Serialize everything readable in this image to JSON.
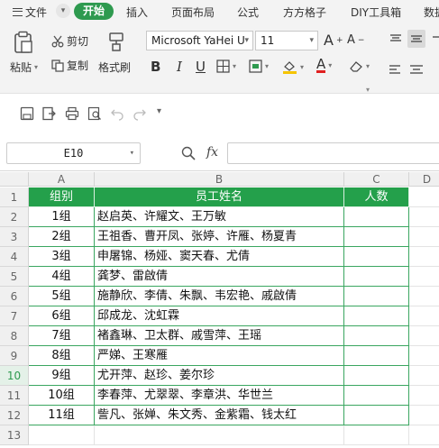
{
  "menubar": {
    "file": "文件",
    "start": "开始",
    "tabs": [
      "插入",
      "页面布局",
      "公式",
      "方方格子",
      "DIY工具箱",
      "数据"
    ]
  },
  "ribbon": {
    "paste": "粘贴",
    "cut": "剪切",
    "copy": "复制",
    "format_painter": "格式刷",
    "font_name": "Microsoft YaHei U",
    "font_size": "11"
  },
  "formula_bar": {
    "cell_ref": "E10",
    "fx": "fx",
    "formula": ""
  },
  "sheet": {
    "columns": [
      "A",
      "B",
      "C",
      "D"
    ],
    "row_numbers": [
      "1",
      "2",
      "3",
      "4",
      "5",
      "6",
      "7",
      "8",
      "9",
      "10",
      "11",
      "12",
      "13"
    ],
    "selected_row": "10",
    "header": [
      "组别",
      "员工姓名",
      "人数"
    ],
    "rows": [
      {
        "group": "1组",
        "names": "赵启英、许耀文、王万敏",
        "count": ""
      },
      {
        "group": "2组",
        "names": "王祖香、曹开凤、张婷、许雁、杨夏青",
        "count": ""
      },
      {
        "group": "3组",
        "names": "申屠锦、杨娅、窦天春、尤倩",
        "count": ""
      },
      {
        "group": "4组",
        "names": "龚梦、雷啟倩",
        "count": ""
      },
      {
        "group": "5组",
        "names": "施静欣、李倩、朱飘、韦宏艳、戚啟倩",
        "count": ""
      },
      {
        "group": "6组",
        "names": "邱成龙、沈虹霖",
        "count": ""
      },
      {
        "group": "7组",
        "names": "褚鑫琳、卫太群、戚雪萍、王瑶",
        "count": ""
      },
      {
        "group": "8组",
        "names": "严娣、王寒雁",
        "count": ""
      },
      {
        "group": "9组",
        "names": "尤开萍、赵珍、姜尔珍",
        "count": ""
      },
      {
        "group": "10组",
        "names": "李春萍、尤翠翠、李章洪、华世兰",
        "count": ""
      },
      {
        "group": "11组",
        "names": "訾凡、张婵、朱文秀、金紫霜、钱太红",
        "count": ""
      }
    ]
  },
  "colors": {
    "accent": "#2e9a4f",
    "header_fill": "#24a04b",
    "header_text": "#ffffff",
    "table_border": "#3aa660"
  }
}
